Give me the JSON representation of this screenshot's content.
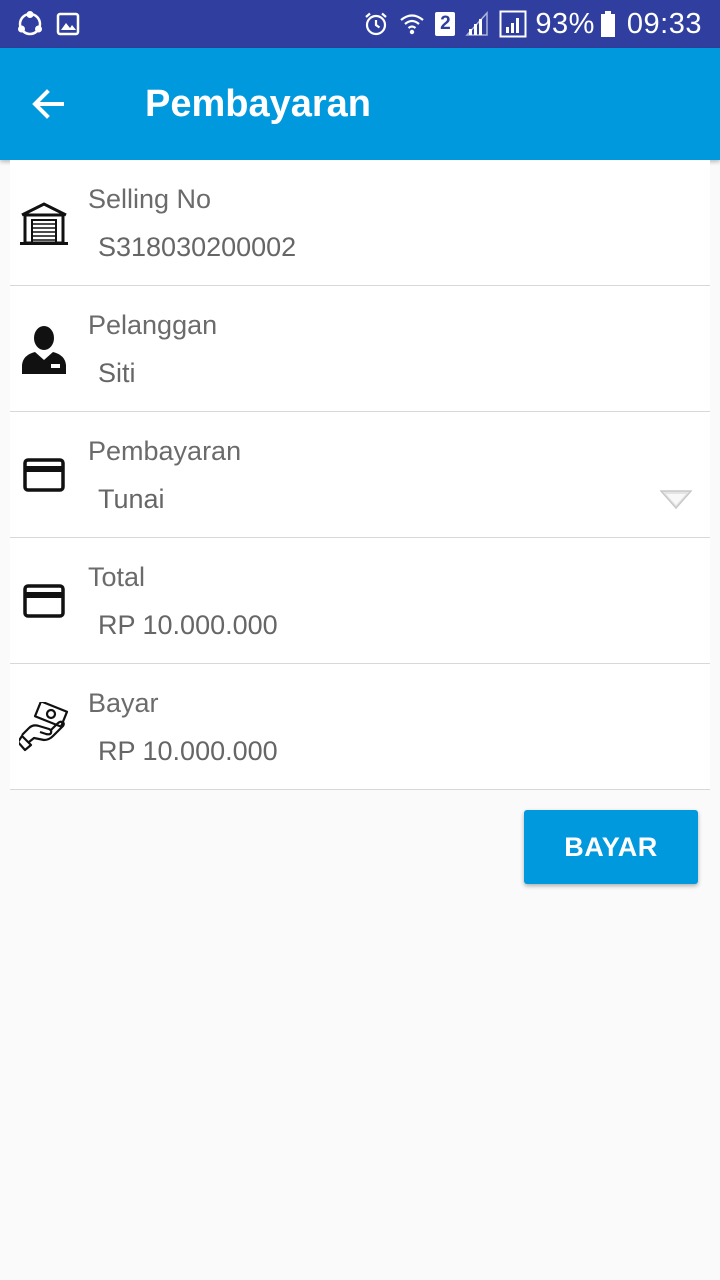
{
  "status_bar": {
    "battery_percent": "93%",
    "time": "09:33",
    "sim_slot": "2"
  },
  "app_bar": {
    "title": "Pembayaran"
  },
  "form": {
    "selling_no": {
      "label": "Selling No",
      "value": "S318030200002",
      "icon": "warehouse-icon"
    },
    "customer": {
      "label": "Pelanggan",
      "value": "Siti",
      "icon": "person-icon"
    },
    "payment_method": {
      "label": "Pembayaran",
      "value": "Tunai",
      "icon": "credit-card-icon"
    },
    "total": {
      "label": "Total",
      "value": "RP 10.000.000",
      "icon": "credit-card-icon"
    },
    "paid": {
      "label": "Bayar",
      "value": "RP 10.000.000",
      "icon": "cash-hand-icon"
    }
  },
  "actions": {
    "pay_label": "BAYAR"
  },
  "colors": {
    "status_bar": "#303F9F",
    "primary": "#0099DD",
    "background": "#fafafa"
  }
}
